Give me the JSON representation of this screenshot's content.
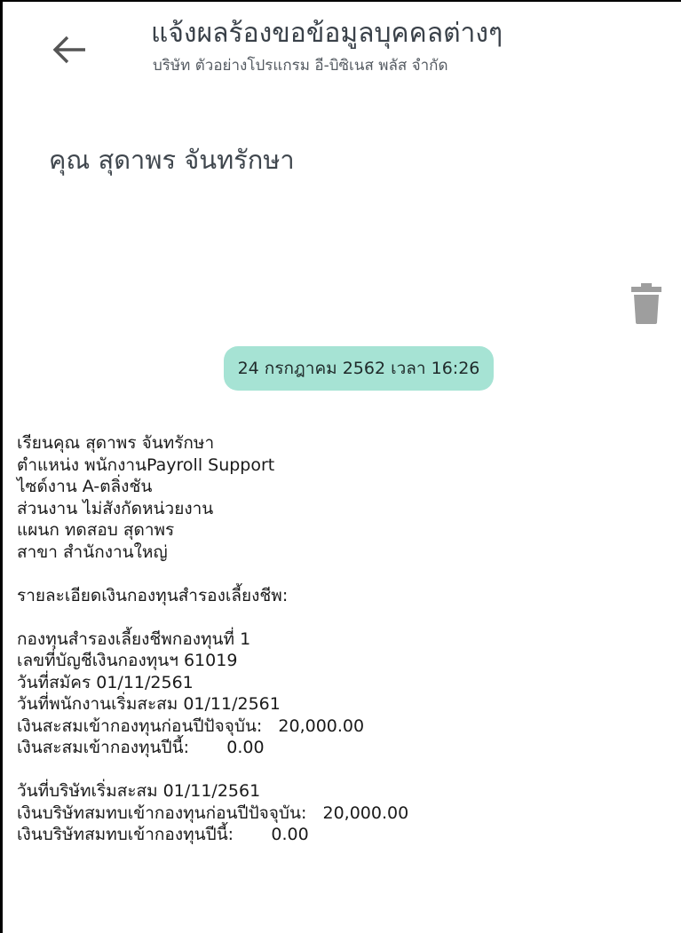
{
  "header": {
    "title": "แจ้งผลร้องขอข้อมูลบุคคลต่างๆ",
    "subtitle": "บริษัท ตัวอย่างโปรแกรม อี-บิซิเนส พลัส  จำกัด",
    "back_icon": "arrow-left-icon"
  },
  "person": {
    "name": "คุณ สุดาพร จันทรักษา"
  },
  "actions": {
    "delete_icon": "trash-icon"
  },
  "message": {
    "date": "24 กรกฎาคม 2562 เวลา 16:26",
    "employee_lines": [
      "เรียนคุณ สุดาพร จันทรักษา",
      "ตำแหน่ง พนักงานPayroll Support",
      "ไซด์งาน A-ตลิ่งชัน",
      "ส่วนงาน ไม่สังกัดหน่วยงาน",
      "แผนก ทดสอบ สุดาพร",
      "สาขา สำนักงานใหญ่"
    ],
    "fund_heading": "รายละเอียดเงินกองทุนสำรองเลี้ยงชีพ:",
    "fund_lines": [
      "กองทุนสำรองเลี้ยงชีพกองทุนที่ 1",
      "เลขที่บัญชีเงินกองทุนฯ 61019",
      "วันที่สมัคร 01/11/2561",
      "วันที่พนักงานเริ่มสะสม 01/11/2561",
      "เงินสะสมเข้ากองทุนก่อนปีปัจจุบัน:   20,000.00",
      "เงินสะสมเข้ากองทุนปีนี้:       0.00"
    ],
    "company_lines": [
      "วันที่บริษัทเริ่มสะสม 01/11/2561",
      "เงินบริษัทสมทบเข้ากองทุนก่อนปีปัจจุบัน:   20,000.00",
      "เงินบริษัทสมทบเข้ากองทุนปีนี้:       0.00"
    ]
  },
  "colors": {
    "date_chip_bg": "#a6e3d4",
    "icon_gray": "#9e9e9e",
    "back_arrow": "#555555"
  }
}
